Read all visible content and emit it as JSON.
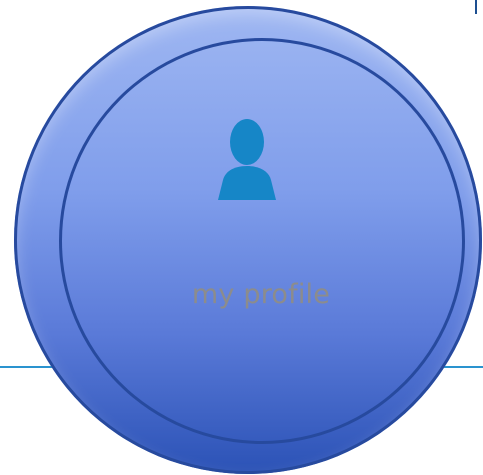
{
  "nav": {
    "items": [
      {
        "id": "my-profile",
        "label": "my profile",
        "icon": "user-icon",
        "active": true
      }
    ]
  },
  "colors": {
    "accent": "#1686c7",
    "nav_line": "#2a93cf",
    "label_text": "#8c8c8c",
    "highlight_ring": "#5a7ad8"
  }
}
